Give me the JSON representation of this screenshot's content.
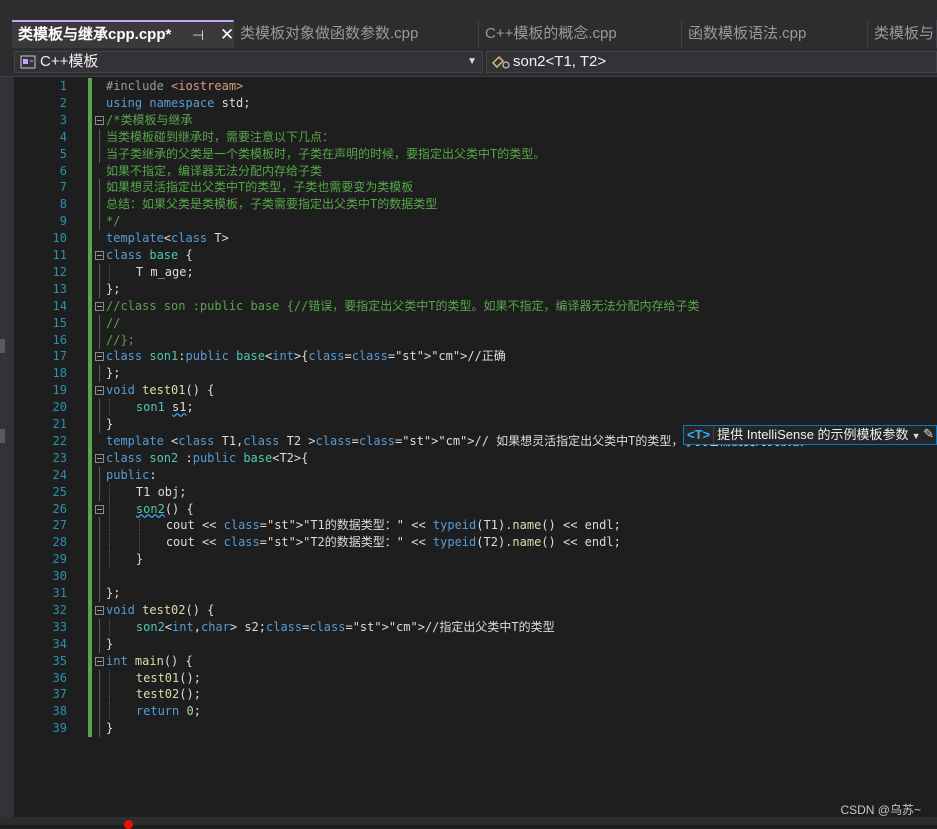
{
  "tabs": [
    {
      "label": "类模板与继承cpp.cpp*",
      "active": true
    },
    {
      "label": "类模板对象做函数参数.cpp",
      "active": false
    },
    {
      "label": "C++模板的概念.cpp",
      "active": false
    },
    {
      "label": "函数模板语法.cpp",
      "active": false
    },
    {
      "label": "类模板与",
      "active": false
    }
  ],
  "icons": {
    "pin": "pin-icon",
    "close": "close-icon",
    "project": "project-icon",
    "member": "member-icon",
    "dropdown": "chevron-down-icon",
    "edit": "pencil-icon"
  },
  "glyphs": {
    "pin": "⊣",
    "close": "✕",
    "drop": "▼",
    "pencil": "✎"
  },
  "navbar": {
    "project": "C++模板",
    "member": "son2<T1, T2>"
  },
  "code_lines": [
    {
      "n": "1",
      "text": "#include <iostream>"
    },
    {
      "n": "2",
      "text": "using namespace std;"
    },
    {
      "n": "3",
      "text": "/*类模板与继承"
    },
    {
      "n": "4",
      "text": "当类模板碰到继承时，需要注意以下几点："
    },
    {
      "n": "5",
      "text": "当子类继承的父类是一个类模板时，子类在声明的时候，要指定出父类中T的类型。"
    },
    {
      "n": "6",
      "text": "如果不指定，编译器无法分配内存给子类"
    },
    {
      "n": "7",
      "text": "如果想灵活指定出父类中T的类型，子类也需要变为类模板"
    },
    {
      "n": "8",
      "text": "总结：如果父类是类模板，子类需要指定出父类中T的数据类型"
    },
    {
      "n": "9",
      "text": "*/"
    },
    {
      "n": "10",
      "text": "template<class T>"
    },
    {
      "n": "11",
      "text": "class base {"
    },
    {
      "n": "12",
      "text": "T m_age;"
    },
    {
      "n": "13",
      "text": "};"
    },
    {
      "n": "14",
      "text": "//class son :public base {//错误，要指定出父类中T的类型。如果不指定，编译器无法分配内存给子类"
    },
    {
      "n": "15",
      "text": "//"
    },
    {
      "n": "16",
      "text": "//};"
    },
    {
      "n": "17",
      "text": "class son1:public base<int>{//正确"
    },
    {
      "n": "18",
      "text": "};"
    },
    {
      "n": "19",
      "text": "void test01() {"
    },
    {
      "n": "20",
      "text": "son1 s1;"
    },
    {
      "n": "21",
      "text": "}"
    },
    {
      "n": "22",
      "text": "template <class T1,class T2 >// 如果想灵活指定出父类中T的类型，子类也需要变为类模板"
    },
    {
      "n": "23",
      "text": "class son2 :public base<T2>{"
    },
    {
      "n": "24",
      "text": "public:"
    },
    {
      "n": "25",
      "text": "T1 obj;"
    },
    {
      "n": "26",
      "text": "son2() {"
    },
    {
      "n": "27",
      "text": "cout << \"T1的数据类型：\" << typeid(T1).name() << endl;"
    },
    {
      "n": "28",
      "text": "cout << \"T2的数据类型：\" << typeid(T2).name() << endl;"
    },
    {
      "n": "29",
      "text": "}"
    },
    {
      "n": "30",
      "text": ""
    },
    {
      "n": "31",
      "text": "};"
    },
    {
      "n": "32",
      "text": "void test02() {"
    },
    {
      "n": "33",
      "text": "son2<int,char> s2;//指定出父类中T的类型"
    },
    {
      "n": "34",
      "text": "}"
    },
    {
      "n": "35",
      "text": "int main() {"
    },
    {
      "n": "36",
      "text": "test01();"
    },
    {
      "n": "37",
      "text": "test02();"
    },
    {
      "n": "38",
      "text": "return 0;"
    },
    {
      "n": "39",
      "text": "}"
    }
  ],
  "intellisense_tip": {
    "badge": "<T>",
    "text": "提供 IntelliSense 的示例模板参数"
  },
  "watermark": "CSDN @乌苏~",
  "colors": {
    "keyword": "#569cd6",
    "comment": "#57a64a",
    "string": "#d69d85",
    "type": "#4ec9b0",
    "function": "#dcdcaa",
    "line_number": "#2b91af",
    "change_bar": "#57a64a",
    "accent_tab": "#c8a2ff",
    "tip_border": "#007acc"
  }
}
